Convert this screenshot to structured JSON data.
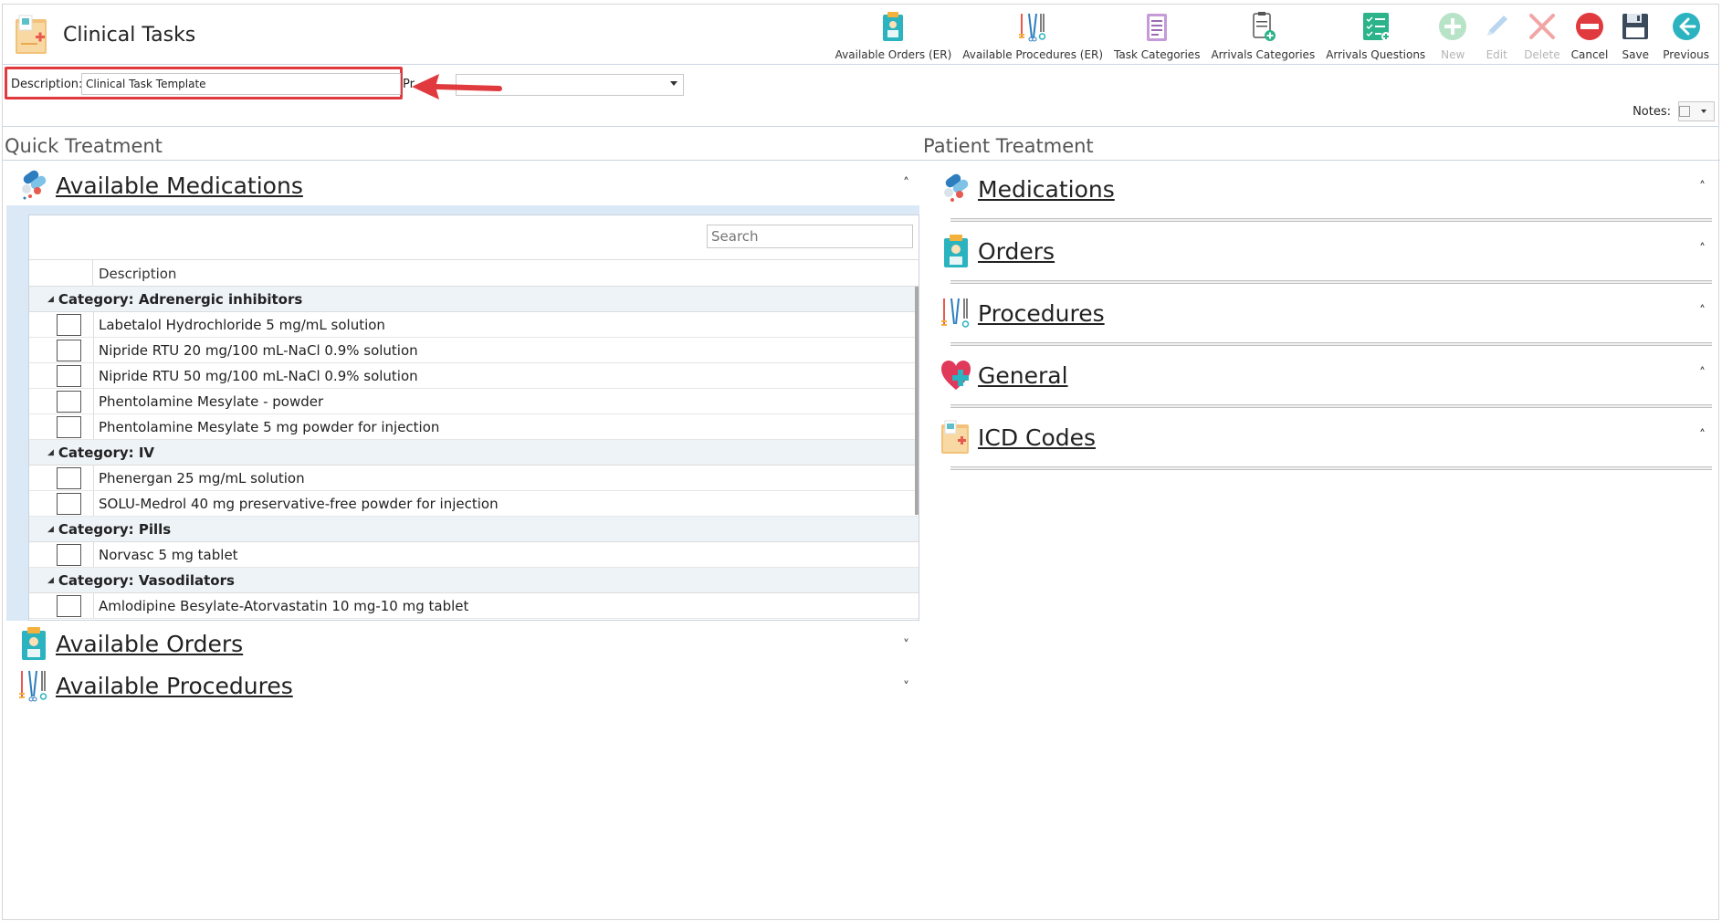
{
  "app": {
    "title": "Clinical Tasks"
  },
  "toolbar": [
    {
      "id": "available-orders",
      "label": "Available Orders (ER)",
      "enabled": true
    },
    {
      "id": "available-procedures",
      "label": "Available Procedures (ER)",
      "enabled": true
    },
    {
      "id": "task-categories",
      "label": "Task Categories",
      "enabled": true
    },
    {
      "id": "arrivals-categories",
      "label": "Arrivals Categories",
      "enabled": true
    },
    {
      "id": "arrivals-questions",
      "label": "Arrivals Questions",
      "enabled": true
    },
    {
      "id": "new",
      "label": "New",
      "enabled": false
    },
    {
      "id": "edit",
      "label": "Edit",
      "enabled": false
    },
    {
      "id": "delete",
      "label": "Delete",
      "enabled": false
    },
    {
      "id": "cancel",
      "label": "Cancel",
      "enabled": true
    },
    {
      "id": "save",
      "label": "Save",
      "enabled": true
    },
    {
      "id": "previous",
      "label": "Previous",
      "enabled": true
    }
  ],
  "form": {
    "description_label": "Description:",
    "description_value": "Clinical Task Template",
    "pr_label": "Pr",
    "pr_value": "",
    "notes_label": "Notes:"
  },
  "quick_treatment": {
    "heading": "Quick Treatment",
    "medications": {
      "title": "Available Medications",
      "search_placeholder": "Search",
      "column_header": "Description",
      "categories": [
        {
          "label": "Category: Adrenergic inhibitors",
          "items": [
            "Labetalol Hydrochloride 5 mg/mL solution",
            "Nipride RTU 20 mg/100 mL-NaCl 0.9% solution",
            "Nipride RTU 50 mg/100 mL-NaCl 0.9% solution",
            "Phentolamine Mesylate - powder",
            "Phentolamine Mesylate 5 mg powder for injection"
          ]
        },
        {
          "label": "Category: IV",
          "items": [
            "Phenergan 25 mg/mL solution",
            "SOLU-Medrol 40 mg preservative-free powder for injection"
          ]
        },
        {
          "label": "Category: Pills",
          "items": [
            "Norvasc 5 mg tablet"
          ]
        },
        {
          "label": "Category: Vasodilators",
          "items": [
            "Amlodipine Besylate-Atorvastatin 10 mg-10 mg tablet"
          ]
        }
      ]
    },
    "orders_title": "Available Orders",
    "procedures_title": "Available Procedures"
  },
  "patient_treatment": {
    "heading": "Patient Treatment",
    "groups": [
      "Medications",
      "Orders",
      "Procedures",
      "General",
      "ICD Codes"
    ]
  },
  "colors": {
    "highlight_border": "#e0393e",
    "panel_bg": "#dbe8f5",
    "accent_teal": "#2bb3c0"
  }
}
